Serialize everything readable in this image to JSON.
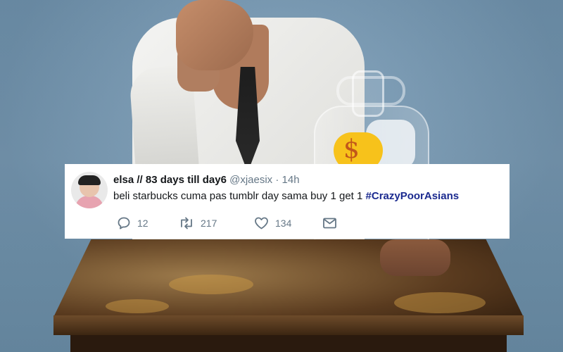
{
  "tweet": {
    "display_name": "elsa // 83 days till day6",
    "handle": "@xjaesix",
    "separator": "·",
    "time": "14h",
    "text": "beli starbucks cuma pas tumblr day sama buy 1 get 1",
    "hashtag": "#CrazyPoorAsians",
    "actions": {
      "replies": "12",
      "retweets": "217",
      "likes": "134"
    },
    "icons": [
      "reply-icon",
      "retweet-icon",
      "like-icon",
      "message-icon"
    ]
  },
  "background": {
    "jar_symbol": "$"
  },
  "colors": {
    "hashtag": "#1b2a8f",
    "muted": "#657786",
    "wall": "#7397b3",
    "coin_tag": "#f7c21b"
  }
}
